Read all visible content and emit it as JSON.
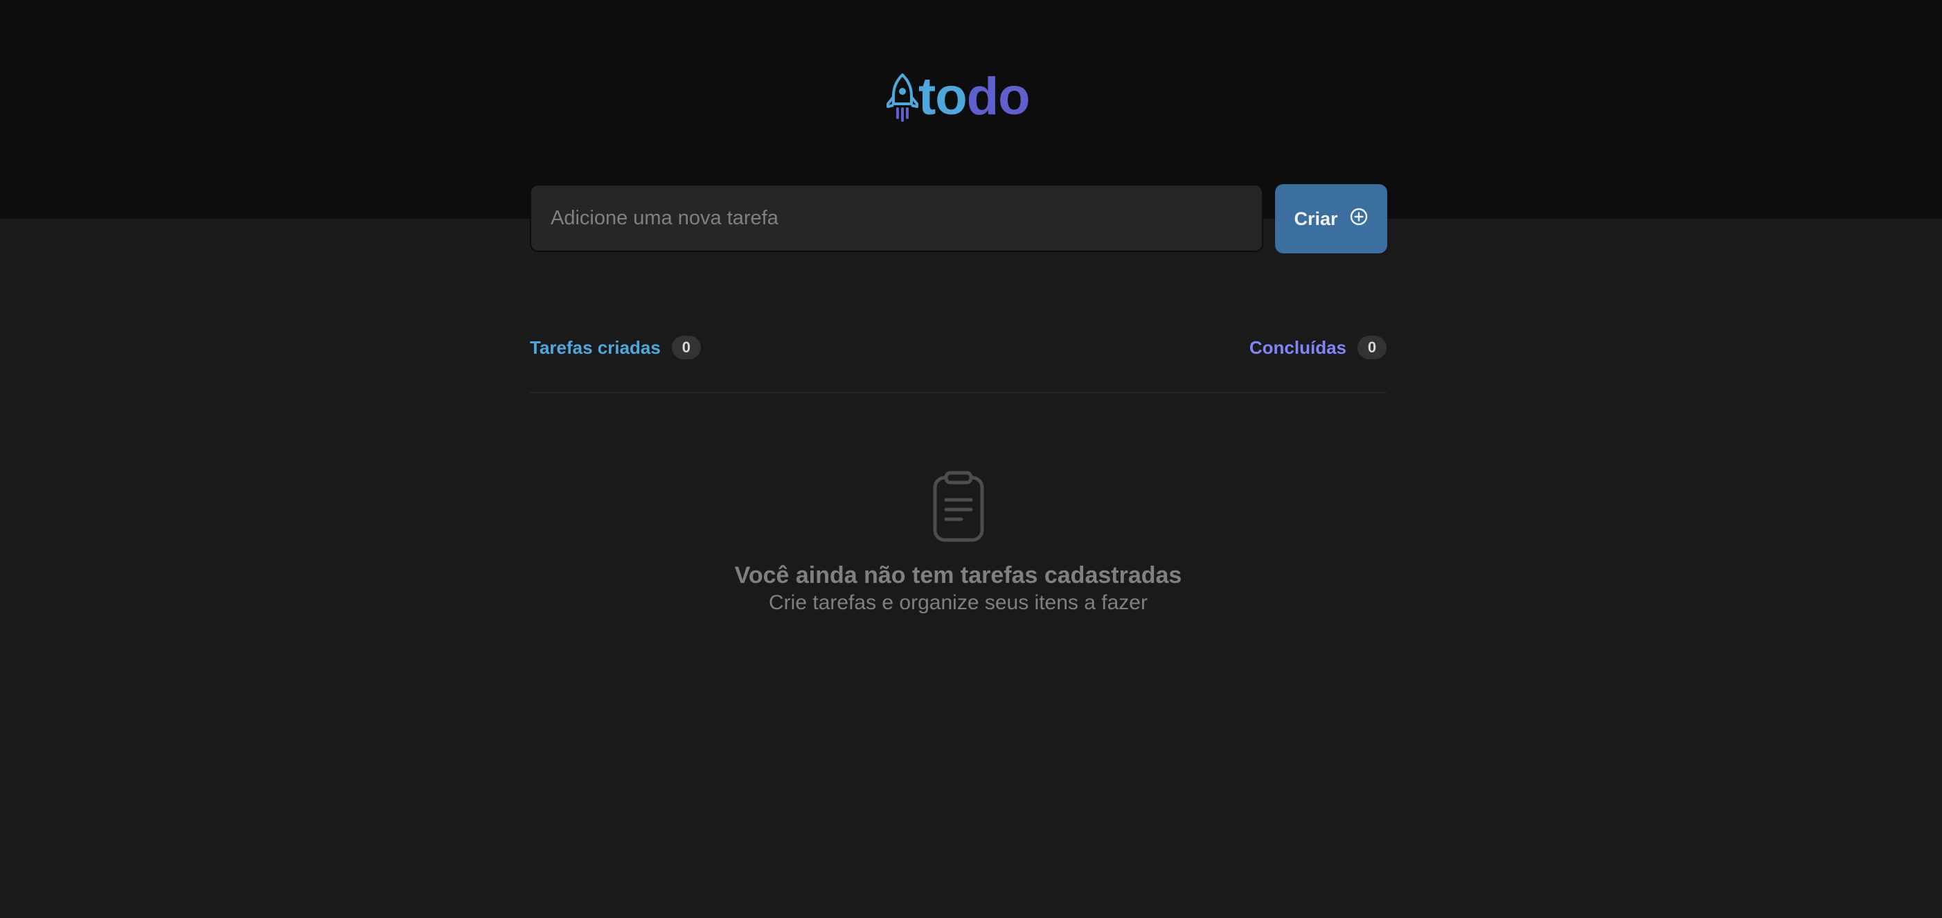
{
  "app": {
    "logo_part1": "to",
    "logo_part2": "do",
    "colors": {
      "blue": "#4ea8de",
      "purple": "#5e60ce",
      "purple_light": "#8284fa",
      "button": "#3b6fa0",
      "header_bg": "#0d0d0d",
      "body_bg": "#1a1a1a"
    }
  },
  "new_task": {
    "placeholder": "Adicione uma nova tarefa",
    "value": "",
    "create_label": "Criar",
    "create_icon": "plus-circle-icon"
  },
  "counters": {
    "created_label": "Tarefas criadas",
    "created_count": "0",
    "done_label": "Concluídas",
    "done_count": "0"
  },
  "empty_state": {
    "icon": "clipboard-icon",
    "title": "Você ainda não tem tarefas cadastradas",
    "subtitle": "Crie tarefas e organize seus itens a fazer"
  }
}
